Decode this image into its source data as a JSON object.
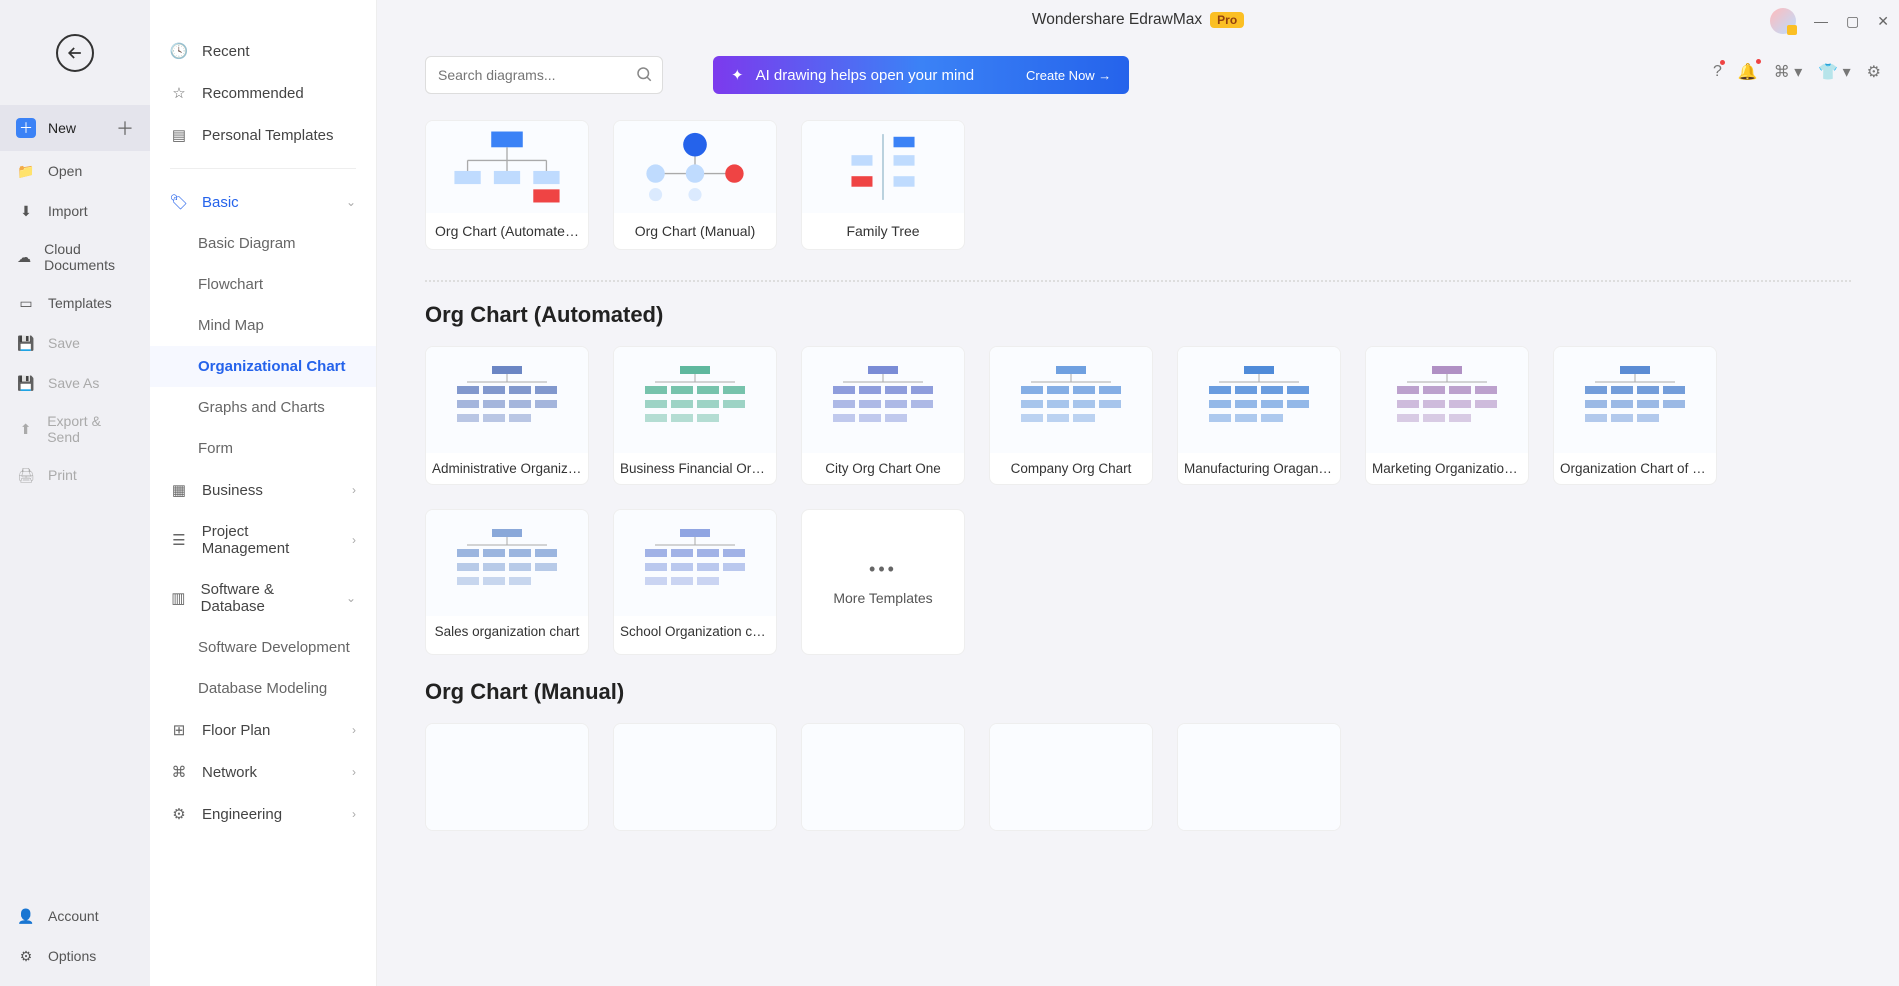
{
  "app": {
    "title": "Wondershare EdrawMax",
    "badge": "Pro"
  },
  "nav": {
    "new": "New",
    "open": "Open",
    "import": "Import",
    "cloud": "Cloud Documents",
    "templates": "Templates",
    "save": "Save",
    "saveas": "Save As",
    "export": "Export & Send",
    "print": "Print",
    "account": "Account",
    "options": "Options"
  },
  "cats": {
    "recent": "Recent",
    "recommended": "Recommended",
    "personal": "Personal Templates",
    "basic": "Basic",
    "basic_sub": {
      "diagram": "Basic Diagram",
      "flowchart": "Flowchart",
      "mindmap": "Mind Map",
      "orgchart": "Organizational Chart",
      "graphs": "Graphs and Charts",
      "form": "Form"
    },
    "business": "Business",
    "pm": "Project Management",
    "software": "Software & Database",
    "software_sub": {
      "dev": "Software Development",
      "db": "Database Modeling"
    },
    "floorplan": "Floor Plan",
    "network": "Network",
    "engineering": "Engineering"
  },
  "search": {
    "placeholder": "Search diagrams..."
  },
  "ai": {
    "text": "AI drawing helps open your mind",
    "cta": "Create Now"
  },
  "top_templates": [
    {
      "label": "Org Chart (Automate…"
    },
    {
      "label": "Org Chart (Manual)"
    },
    {
      "label": "Family Tree"
    }
  ],
  "sections": [
    {
      "title": "Org Chart (Automated)",
      "items": [
        "Administrative Organizatio…",
        "Business Financial Organiz…",
        "City Org Chart One",
        "Company Org Chart",
        "Manufacturing Oraganizati…",
        "Marketing Organization Ch…",
        "Organization Chart of Sale…",
        "Sales organization chart",
        "School Organization chart"
      ],
      "more": "More Templates"
    },
    {
      "title": "Org Chart (Manual)",
      "items": []
    }
  ]
}
